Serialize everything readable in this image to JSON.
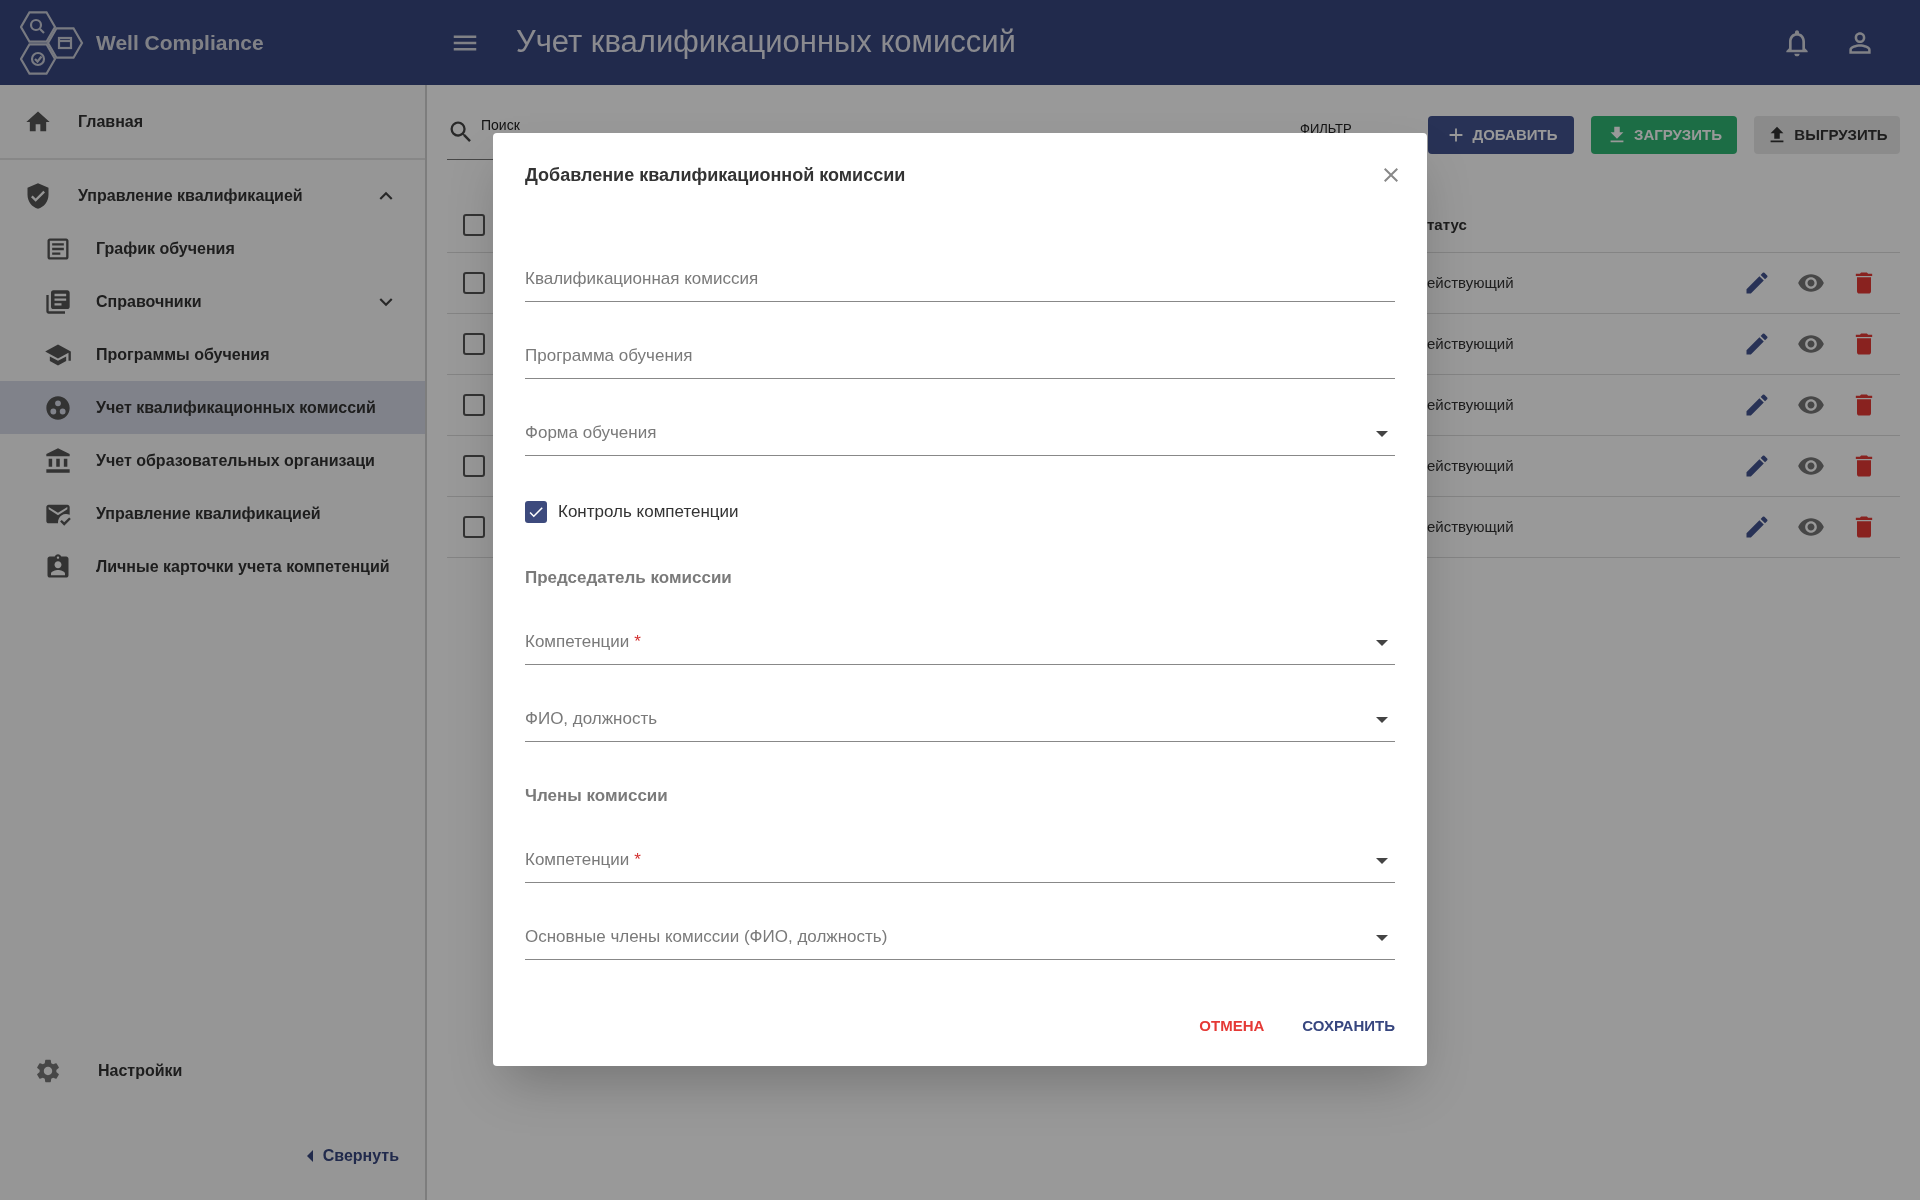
{
  "header": {
    "app_name": "Well Compliance",
    "title": "Учет квалификационных комиссий"
  },
  "sidebar": {
    "items": [
      {
        "label": "Главная",
        "selected": false
      },
      {
        "label": "Управление квалификацией",
        "selected": false,
        "expanded": true,
        "children": [
          {
            "label": "График обучения",
            "selected": false
          },
          {
            "label": "Справочники",
            "selected": false,
            "expanded": false
          },
          {
            "label": "Программы обучения",
            "selected": false
          },
          {
            "label": "Учет квалификационных комиссий",
            "selected": true
          },
          {
            "label": "Учет образовательных организаци",
            "selected": false
          },
          {
            "label": "Управление квалификацией",
            "selected": false
          },
          {
            "label": "Личные карточки учета компетенций",
            "selected": false
          }
        ]
      }
    ],
    "settings": "Настройки",
    "collapse": "Свернуть"
  },
  "toolbar": {
    "search": {
      "placeholder": "Поиск"
    },
    "filter": "ФИЛЬТР",
    "buttons": [
      {
        "kind": "add",
        "label": "ДОБАВИТЬ"
      },
      {
        "kind": "upload",
        "label": "ЗАГРУЗИТЬ"
      },
      {
        "kind": "export",
        "label": "ВЫГРУЗИТЬ"
      }
    ]
  },
  "table": {
    "header": {
      "checked": false,
      "status": "татус"
    },
    "rows": [
      {
        "checked": false,
        "status": "ействующий"
      },
      {
        "checked": false,
        "status": "ействующий"
      },
      {
        "checked": false,
        "status": "ействующий"
      },
      {
        "checked": false,
        "status": "ействующий"
      },
      {
        "checked": false,
        "status": "ействующий"
      }
    ]
  },
  "dialog": {
    "title": "Добавление квалификационной комиссии",
    "form": [
      {
        "kind": "text",
        "placeholder": "Квалификационная комиссия"
      },
      {
        "kind": "text",
        "placeholder": "Программа обучения"
      },
      {
        "kind": "select",
        "placeholder": "Форма обучения"
      },
      {
        "kind": "checkbox",
        "label": "Контроль компетенции",
        "checked": true
      },
      {
        "kind": "heading",
        "label": "Председатель комиссии"
      },
      {
        "kind": "select",
        "placeholder": "Компетенции",
        "required_mark": "*"
      },
      {
        "kind": "select",
        "placeholder": "ФИО, должность"
      },
      {
        "kind": "heading",
        "label": "Члены комиссии"
      },
      {
        "kind": "select",
        "placeholder": "Компетенции",
        "required_mark": "*"
      },
      {
        "kind": "select",
        "placeholder": "Основные члены комиссии (ФИО, должность)"
      }
    ],
    "buttons": [
      {
        "kind": "cancel",
        "label": "ОТМЕНА"
      },
      {
        "kind": "save",
        "label": "СОХРАНИТЬ"
      }
    ]
  }
}
